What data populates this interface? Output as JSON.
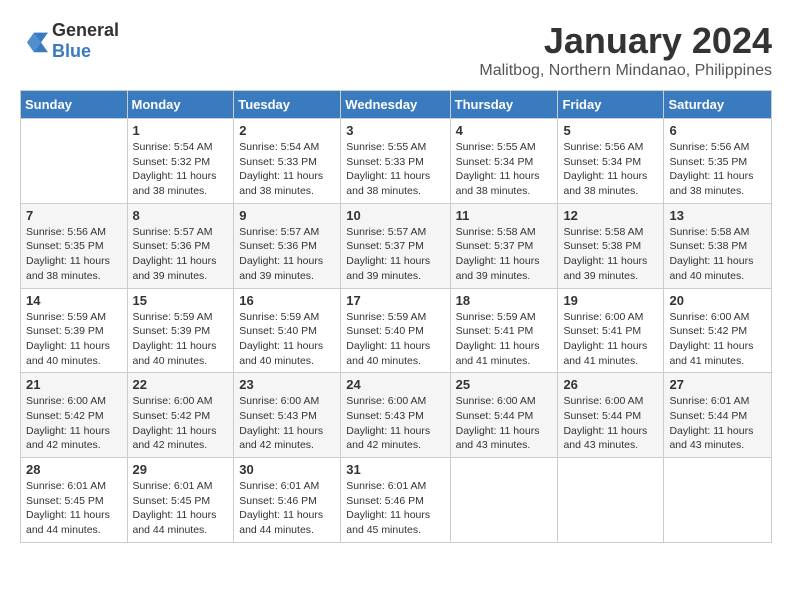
{
  "header": {
    "logo_general": "General",
    "logo_blue": "Blue",
    "month_year": "January 2024",
    "location": "Malitbog, Northern Mindanao, Philippines"
  },
  "weekdays": [
    "Sunday",
    "Monday",
    "Tuesday",
    "Wednesday",
    "Thursday",
    "Friday",
    "Saturday"
  ],
  "weeks": [
    [
      {
        "day": "",
        "info": ""
      },
      {
        "day": "1",
        "info": "Sunrise: 5:54 AM\nSunset: 5:32 PM\nDaylight: 11 hours\nand 38 minutes."
      },
      {
        "day": "2",
        "info": "Sunrise: 5:54 AM\nSunset: 5:33 PM\nDaylight: 11 hours\nand 38 minutes."
      },
      {
        "day": "3",
        "info": "Sunrise: 5:55 AM\nSunset: 5:33 PM\nDaylight: 11 hours\nand 38 minutes."
      },
      {
        "day": "4",
        "info": "Sunrise: 5:55 AM\nSunset: 5:34 PM\nDaylight: 11 hours\nand 38 minutes."
      },
      {
        "day": "5",
        "info": "Sunrise: 5:56 AM\nSunset: 5:34 PM\nDaylight: 11 hours\nand 38 minutes."
      },
      {
        "day": "6",
        "info": "Sunrise: 5:56 AM\nSunset: 5:35 PM\nDaylight: 11 hours\nand 38 minutes."
      }
    ],
    [
      {
        "day": "7",
        "info": "Sunrise: 5:56 AM\nSunset: 5:35 PM\nDaylight: 11 hours\nand 38 minutes."
      },
      {
        "day": "8",
        "info": "Sunrise: 5:57 AM\nSunset: 5:36 PM\nDaylight: 11 hours\nand 39 minutes."
      },
      {
        "day": "9",
        "info": "Sunrise: 5:57 AM\nSunset: 5:36 PM\nDaylight: 11 hours\nand 39 minutes."
      },
      {
        "day": "10",
        "info": "Sunrise: 5:57 AM\nSunset: 5:37 PM\nDaylight: 11 hours\nand 39 minutes."
      },
      {
        "day": "11",
        "info": "Sunrise: 5:58 AM\nSunset: 5:37 PM\nDaylight: 11 hours\nand 39 minutes."
      },
      {
        "day": "12",
        "info": "Sunrise: 5:58 AM\nSunset: 5:38 PM\nDaylight: 11 hours\nand 39 minutes."
      },
      {
        "day": "13",
        "info": "Sunrise: 5:58 AM\nSunset: 5:38 PM\nDaylight: 11 hours\nand 40 minutes."
      }
    ],
    [
      {
        "day": "14",
        "info": "Sunrise: 5:59 AM\nSunset: 5:39 PM\nDaylight: 11 hours\nand 40 minutes."
      },
      {
        "day": "15",
        "info": "Sunrise: 5:59 AM\nSunset: 5:39 PM\nDaylight: 11 hours\nand 40 minutes."
      },
      {
        "day": "16",
        "info": "Sunrise: 5:59 AM\nSunset: 5:40 PM\nDaylight: 11 hours\nand 40 minutes."
      },
      {
        "day": "17",
        "info": "Sunrise: 5:59 AM\nSunset: 5:40 PM\nDaylight: 11 hours\nand 40 minutes."
      },
      {
        "day": "18",
        "info": "Sunrise: 5:59 AM\nSunset: 5:41 PM\nDaylight: 11 hours\nand 41 minutes."
      },
      {
        "day": "19",
        "info": "Sunrise: 6:00 AM\nSunset: 5:41 PM\nDaylight: 11 hours\nand 41 minutes."
      },
      {
        "day": "20",
        "info": "Sunrise: 6:00 AM\nSunset: 5:42 PM\nDaylight: 11 hours\nand 41 minutes."
      }
    ],
    [
      {
        "day": "21",
        "info": "Sunrise: 6:00 AM\nSunset: 5:42 PM\nDaylight: 11 hours\nand 42 minutes."
      },
      {
        "day": "22",
        "info": "Sunrise: 6:00 AM\nSunset: 5:42 PM\nDaylight: 11 hours\nand 42 minutes."
      },
      {
        "day": "23",
        "info": "Sunrise: 6:00 AM\nSunset: 5:43 PM\nDaylight: 11 hours\nand 42 minutes."
      },
      {
        "day": "24",
        "info": "Sunrise: 6:00 AM\nSunset: 5:43 PM\nDaylight: 11 hours\nand 42 minutes."
      },
      {
        "day": "25",
        "info": "Sunrise: 6:00 AM\nSunset: 5:44 PM\nDaylight: 11 hours\nand 43 minutes."
      },
      {
        "day": "26",
        "info": "Sunrise: 6:00 AM\nSunset: 5:44 PM\nDaylight: 11 hours\nand 43 minutes."
      },
      {
        "day": "27",
        "info": "Sunrise: 6:01 AM\nSunset: 5:44 PM\nDaylight: 11 hours\nand 43 minutes."
      }
    ],
    [
      {
        "day": "28",
        "info": "Sunrise: 6:01 AM\nSunset: 5:45 PM\nDaylight: 11 hours\nand 44 minutes."
      },
      {
        "day": "29",
        "info": "Sunrise: 6:01 AM\nSunset: 5:45 PM\nDaylight: 11 hours\nand 44 minutes."
      },
      {
        "day": "30",
        "info": "Sunrise: 6:01 AM\nSunset: 5:46 PM\nDaylight: 11 hours\nand 44 minutes."
      },
      {
        "day": "31",
        "info": "Sunrise: 6:01 AM\nSunset: 5:46 PM\nDaylight: 11 hours\nand 45 minutes."
      },
      {
        "day": "",
        "info": ""
      },
      {
        "day": "",
        "info": ""
      },
      {
        "day": "",
        "info": ""
      }
    ]
  ]
}
